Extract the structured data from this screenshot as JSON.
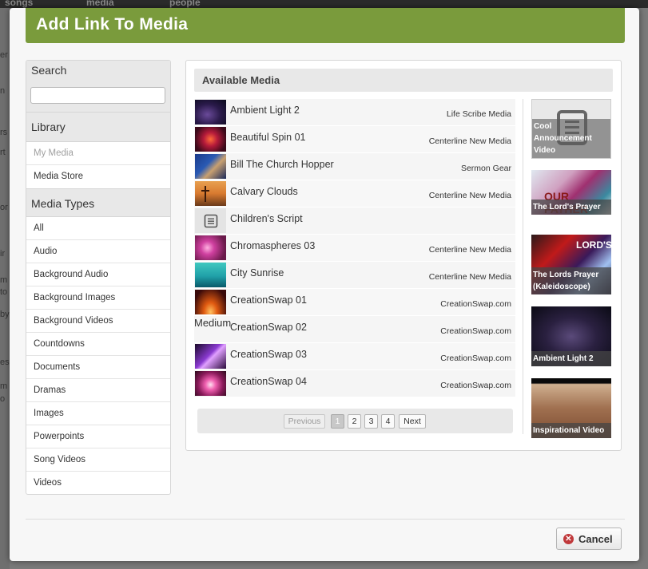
{
  "background": {
    "nav_items": [
      "songs",
      "media",
      "people"
    ],
    "left_letters": [
      "er",
      "n",
      "rs",
      "rt",
      "or",
      "ir",
      "m",
      "to",
      "by",
      "es",
      "m",
      "o"
    ]
  },
  "modal": {
    "title": "Add Link To Media"
  },
  "sidebar": {
    "search_label": "Search",
    "search_value": "",
    "library_label": "Library",
    "library_items": [
      {
        "label": "My Media",
        "selected": true
      },
      {
        "label": "Media Store",
        "selected": false
      }
    ],
    "types_label": "Media Types",
    "type_items": [
      {
        "label": "All"
      },
      {
        "label": "Audio"
      },
      {
        "label": "Background Audio"
      },
      {
        "label": "Background Images"
      },
      {
        "label": "Background Videos"
      },
      {
        "label": "Countdowns"
      },
      {
        "label": "Documents"
      },
      {
        "label": "Dramas"
      },
      {
        "label": "Images"
      },
      {
        "label": "Powerpoints"
      },
      {
        "label": "Song Videos"
      },
      {
        "label": "Videos"
      }
    ]
  },
  "main": {
    "header": "Available Media",
    "stray_label": "Medium",
    "media": [
      {
        "title": "Ambient Light 2",
        "provider": "Life Scribe Media",
        "thumb": "dark-purple"
      },
      {
        "title": "Beautiful Spin 01",
        "provider": "Centerline New Media",
        "thumb": "red-sparkle"
      },
      {
        "title": "Bill The Church Hopper",
        "provider": "Sermon Gear",
        "thumb": "person-blue"
      },
      {
        "title": "Calvary Clouds",
        "provider": "Centerline New Media",
        "thumb": "crosses-orange"
      },
      {
        "title": "Children's Script",
        "provider": "",
        "thumb": "document-icon"
      },
      {
        "title": "Chromaspheres 03",
        "provider": "Centerline New Media",
        "thumb": "pink-orbs"
      },
      {
        "title": "City Sunrise",
        "provider": "Centerline New Media",
        "thumb": "teal-city"
      },
      {
        "title": "CreationSwap 01",
        "provider": "CreationSwap.com",
        "thumb": "orange-rays"
      },
      {
        "title": "CreationSwap 02",
        "provider": "CreationSwap.com",
        "thumb": "none"
      },
      {
        "title": "CreationSwap 03",
        "provider": "CreationSwap.com",
        "thumb": "purple-rays"
      },
      {
        "title": "CreationSwap 04",
        "provider": "CreationSwap.com",
        "thumb": "pink-burst"
      }
    ],
    "pager": {
      "previous": "Previous",
      "pages": [
        "1",
        "2",
        "3",
        "4"
      ],
      "current": "1",
      "next": "Next"
    },
    "featured": [
      {
        "caption": "Cool Announcement Video",
        "style": "document"
      },
      {
        "caption": "The Lord's Prayer",
        "style": "our-father",
        "art_text": "OUR FATHER"
      },
      {
        "caption": "The Lords Prayer (Kaleidoscope)",
        "style": "lords-kaleido",
        "art_text": "LORD'S"
      },
      {
        "caption": "Ambient Light 2",
        "style": "dark"
      },
      {
        "caption": "Inspirational Video",
        "style": "people"
      }
    ]
  },
  "footer": {
    "cancel_label": "Cancel"
  },
  "colors": {
    "header_green": "#7a9b3c",
    "cancel_red": "#c0393b"
  }
}
